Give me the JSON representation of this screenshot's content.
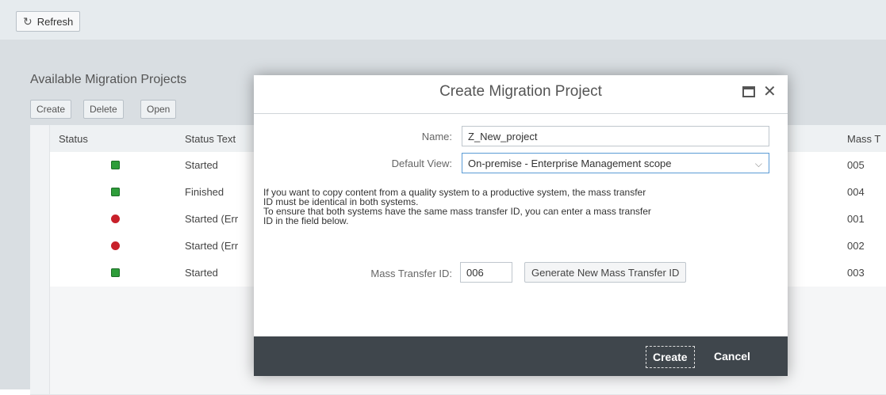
{
  "toolbar": {
    "refresh_label": "Refresh"
  },
  "panel": {
    "title": "Available Migration Projects",
    "buttons": {
      "create": "Create",
      "delete": "Delete",
      "open": "Open"
    }
  },
  "table": {
    "headers": {
      "status": "Status",
      "status_text": "Status Text",
      "mass": "Mass T"
    },
    "rows": [
      {
        "status": "green",
        "status_text": "Started",
        "mass": "005"
      },
      {
        "status": "green",
        "status_text": "Finished",
        "mass": "004"
      },
      {
        "status": "red",
        "status_text": "Started (Err",
        "mass": "001"
      },
      {
        "status": "red",
        "status_text": "Started (Err",
        "mass": "002"
      },
      {
        "status": "green",
        "status_text": "Started",
        "mass": "003"
      }
    ]
  },
  "dialog": {
    "title": "Create Migration Project",
    "name_label": "Name:",
    "name_value": "Z_New_project",
    "view_label": "Default View:",
    "view_value": "On-premise - Enterprise Management scope",
    "info_line1": "If you want to copy content from a quality system to a productive system, the mass transfer",
    "info_line2": "ID must be identical in both systems.",
    "info_line3": "To ensure that both systems have the same mass transfer ID, you can enter a mass transfer",
    "info_line4": "ID in the field below.",
    "mass_label": "Mass Transfer ID:",
    "mass_value": "006",
    "generate_label": "Generate New Mass Transfer ID",
    "create_label": "Create",
    "cancel_label": "Cancel"
  },
  "colors": {
    "status_green": "#2e9d3a",
    "status_red": "#c8202a",
    "footer": "#3f464c"
  }
}
